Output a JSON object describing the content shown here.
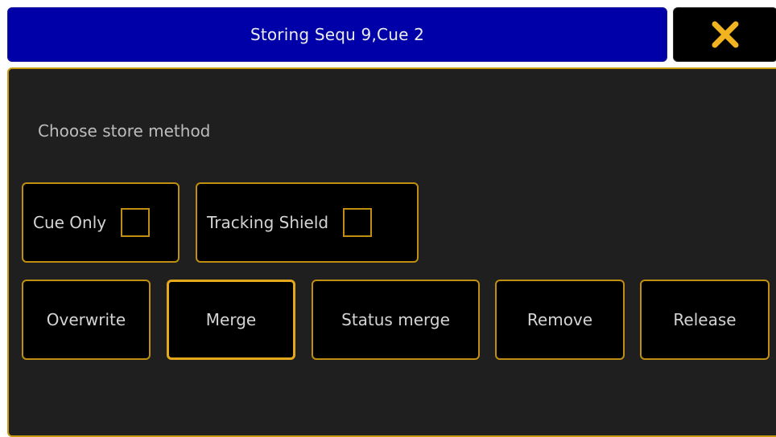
{
  "dialog": {
    "title": "Storing Sequ 9,Cue 2",
    "close_icon": "close-x-icon",
    "accent_color": "#c08e10",
    "title_bg_color": "#0000a8",
    "close_icon_color": "#f2b320"
  },
  "prompt": "Choose store method",
  "options": {
    "cue_only": {
      "label": "Cue Only",
      "checked": false
    },
    "tracking_shield": {
      "label": "Tracking Shield",
      "checked": false
    }
  },
  "methods": [
    {
      "label": "Overwrite",
      "selected": false
    },
    {
      "label": "Merge",
      "selected": true
    },
    {
      "label": "Status merge",
      "selected": false
    },
    {
      "label": "Remove",
      "selected": false
    },
    {
      "label": "Release",
      "selected": false
    }
  ]
}
